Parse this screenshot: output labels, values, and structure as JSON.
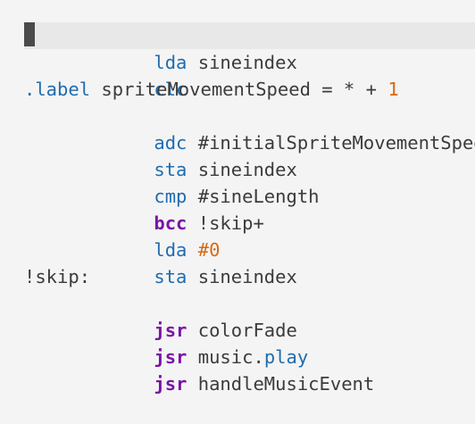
{
  "editor": {
    "lines": [
      {
        "op": "lda",
        "arg": "sineindex"
      },
      {
        "op": "clc"
      },
      {
        "directive": ".label",
        "name": "spriteMovementSpeed",
        "expr": " = * + ",
        "value": "1"
      },
      {
        "op": "adc",
        "arg": "#initialSpriteMovementSpeed"
      },
      {
        "op": "sta",
        "arg": "sineindex"
      },
      {
        "op": "cmp",
        "arg": "#sineLength"
      },
      {
        "op": "bcc",
        "arg": "!skip+"
      },
      {
        "op": "lda",
        "arg": "#0"
      },
      {
        "op": "sta",
        "arg": "sineindex"
      },
      {
        "label": "!skip:"
      },
      {
        "op": "jsr",
        "arg": "colorFade"
      },
      {
        "op": "jsr",
        "arg_obj": "music.",
        "arg_member": "play"
      },
      {
        "op": "jsr",
        "arg": "handleMusicEvent"
      }
    ]
  },
  "colors": {
    "background": "#f4f4f4",
    "current_line": "#e8e8e8",
    "keyword_blue": "#1f6cb0",
    "keyword_purple": "#7b12a6",
    "number_orange": "#d46a15",
    "text": "#3b3b3b"
  }
}
